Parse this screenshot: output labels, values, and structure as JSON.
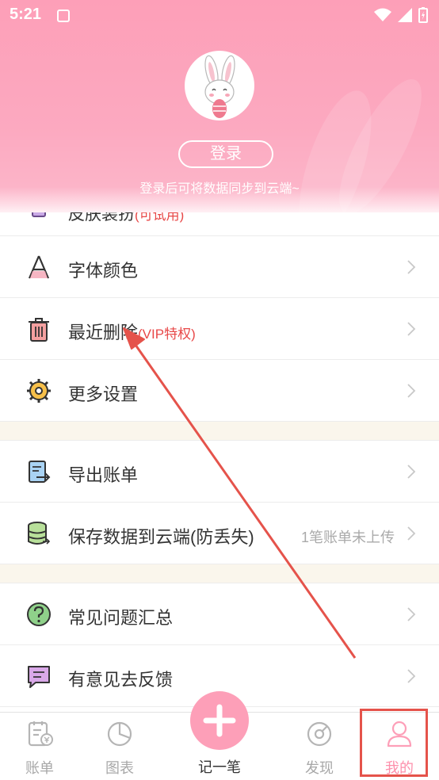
{
  "status_bar": {
    "time": "5:21"
  },
  "header": {
    "login_button": "登录",
    "sync_hint": "登录后可将数据同步到云端~",
    "partial_row_label": "皮肤装扮",
    "partial_row_tag": "(可试用)"
  },
  "menu": {
    "font_color": "字体颜色",
    "recent_delete": "最近删除",
    "recent_delete_tag": "(VIP特权)",
    "more_settings": "更多设置",
    "export_bill": "导出账单",
    "save_cloud": "保存数据到云端(防丢失)",
    "save_cloud_status": "1笔账单未上传",
    "faq": "常见问题汇总",
    "feedback": "有意见去反馈"
  },
  "tabs": {
    "bill": "账单",
    "chart": "图表",
    "record": "记一笔",
    "discover": "发现",
    "mine": "我的"
  },
  "colors": {
    "brand_pink": "#fd9fb8",
    "vip_red": "#e84848",
    "annotation_red": "#e5534b"
  }
}
